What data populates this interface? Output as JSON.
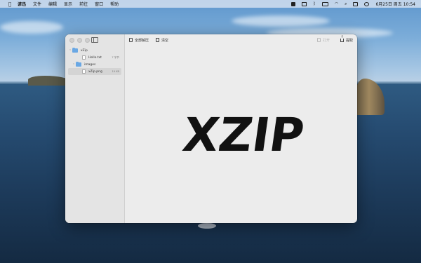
{
  "menubar": {
    "app_name": "谚迅",
    "menus": [
      "文件",
      "编辑",
      "显示",
      "前往",
      "窗口",
      "帮助"
    ],
    "clock": "6月25日 周五 10:54"
  },
  "window": {
    "toolbar": {
      "extract_all_label": "全部解压",
      "clear_label": "清空",
      "open_label": "打开",
      "share_label": "提取"
    },
    "tree": [
      {
        "name": "xZip",
        "type": "folder",
        "expanded": true,
        "depth": 0,
        "size": ""
      },
      {
        "name": "Hello.txt",
        "type": "file",
        "depth": 1,
        "size": "7 字节"
      },
      {
        "name": "images",
        "type": "folder",
        "expanded": true,
        "depth": 1,
        "size": ""
      },
      {
        "name": "xZip.png",
        "type": "file",
        "depth": 2,
        "size": "19 KB",
        "selected": true
      }
    ],
    "preview": {
      "logo_text": "XZIP"
    }
  }
}
